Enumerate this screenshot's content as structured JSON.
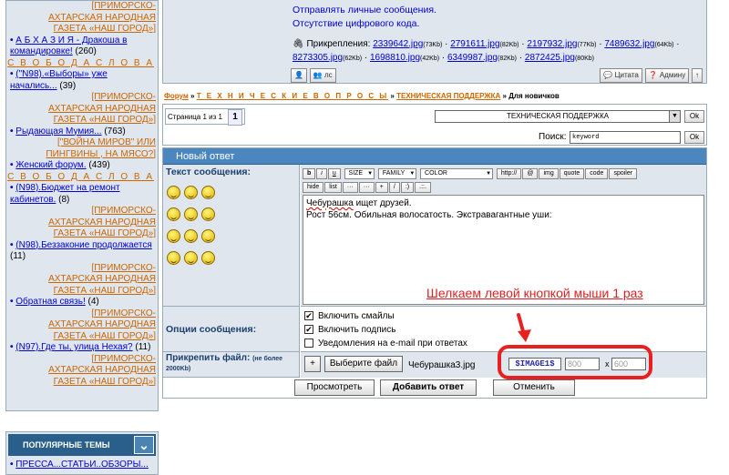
{
  "sidebar": {
    "items": [
      {
        "sub": "[ПРИМОРСКО-АХТАРСКАЯ НАРОДНАЯ ГАЗЕТА «НАШ ГОРОД»]"
      },
      {
        "title": "А Б Х А З И Я - Дракоша в командировке!",
        "count": "(260)",
        "sub2": "С В О Б О Д А С Л О В А"
      },
      {
        "title": "(\"N98).«Выборы» уже начались...",
        "count": "(39)",
        "sub": "[ПРИМОРСКО-АХТАРСКАЯ НАРОДНАЯ ГАЗЕТА «НАШ ГОРОД»]"
      },
      {
        "title": "Рыдающая Мумия...",
        "count": "(763)",
        "sub": "[\"ВОЙНА МИРОВ\" ИЛИ ПИНГВИНЫ , НА МЯСО?]"
      },
      {
        "title": "Женский форум.",
        "count": "(439)",
        "sub2": "С В О Б О Д А С Л О В А"
      },
      {
        "title": "(N98).Бюджет на ремонт кабинетов.",
        "count": "(8)",
        "sub": "[ПРИМОРСКО-АХТАРСКАЯ НАРОДНАЯ ГАЗЕТА «НАШ ГОРОД»]"
      },
      {
        "title": "(N98).Беззаконие продолжается",
        "count": "(11)",
        "sub": "[ПРИМОРСКО-АХТАРСКАЯ НАРОДНАЯ ГАЗЕТА «НАШ ГОРОД»]"
      },
      {
        "title": "Обратная связь!",
        "count": "(4)",
        "sub": "[ПРИМОРСКО-АХТАРСКАЯ НАРОДНАЯ ГАЗЕТА «НАШ ГОРОД»]"
      },
      {
        "title": "(N97).Где ты, улица Нехая?",
        "count": "(11)",
        "sub": "[ПРИМОРСКО-АХТАРСКАЯ НАРОДНАЯ ГАЗЕТА «НАШ ГОРОД»]"
      }
    ]
  },
  "popular": {
    "title": "ПОПУЛЯРНЫЕ ТЕМЫ",
    "first_item": "ПРЕССА...СТАТЬИ..ОБЗОРЫ..."
  },
  "post": {
    "lines": [
      "Отправлять личные сообщения.",
      "Отсутствие цифрового кода."
    ],
    "attach_label": "Прикрепления:",
    "attachments": [
      {
        "name": "2339642.jpg",
        "size": "(73Kb)"
      },
      {
        "name": "2791611.jpg",
        "size": "(82Kb)"
      },
      {
        "name": "2197932.jpg",
        "size": "(77Kb)"
      },
      {
        "name": "7489632.jpg",
        "size": "(64Kb)"
      },
      {
        "name": "8273305.jpg",
        "size": "(62Kb)"
      },
      {
        "name": "1698810.jpg",
        "size": "(42Kb)"
      },
      {
        "name": "6349987.jpg",
        "size": "(82Kb)"
      },
      {
        "name": "2872425.jpg",
        "size": "(80Kb)"
      }
    ],
    "pm_label": "лс",
    "quote_label": "Цитата",
    "admin_label": "Админу"
  },
  "breadcrumb": {
    "forum": "Форум",
    "sep": "»",
    "section": "Т Е Х Н И Ч Е С К И Е В О П Р О С Ы",
    "subsection": "ТЕХНИЧЕСКАЯ ПОДДЕРЖКА",
    "current": "Для новичков"
  },
  "pager": {
    "label": "Страница 1 из 1",
    "current": "1",
    "forum_select": "ТЕХНИЧЕСКАЯ ПОДДЕРЖКА",
    "ok": "Ok",
    "search_label": "Поиск:",
    "search_value": "keyword"
  },
  "form": {
    "title": "Новый ответ",
    "msg_label": "Текст сообщения:",
    "options_label": "Опции сообщения:",
    "attach_label": "Прикрепить файл:",
    "attach_note": "(не более 2000Kb)",
    "toolbar_row1": [
      "b",
      "i",
      "u"
    ],
    "size": "SIZE",
    "family": "FAMILY",
    "color": "COLOR",
    "toolbar_row1b": [
      "http://",
      "@",
      "img",
      "quote",
      "code",
      "spoiler"
    ],
    "toolbar_row2": [
      "hide",
      "list",
      "···",
      "···",
      "+",
      "/",
      ":)",
      ".::."
    ],
    "text_line1_word": "Чебурашка",
    "text_line1_rest": " ищет друзей.",
    "text_line2": "Рост 56см. Обильная волосатость. Экстравагантные уши:",
    "hint": "Шелкаем левой кнопкой мыши 1 раз",
    "opt_smiles": "Включить смайлы",
    "opt_signature": "Включить подпись",
    "opt_email": "Уведомления на e-mail при ответах",
    "plus": "+",
    "choose_file": "Выберите файл",
    "filename": "Чебурашка3.jpg",
    "image_tag": "$IMAGE1$",
    "width": "800",
    "x": "x",
    "height": "600",
    "preview": "Просмотреть",
    "submit": "Добавить ответ",
    "cancel": "Отменить"
  },
  "colors": {
    "accent": "#4c86be",
    "link": "#0000cc",
    "orange": "#cc6600",
    "highlight": "#e82020"
  }
}
